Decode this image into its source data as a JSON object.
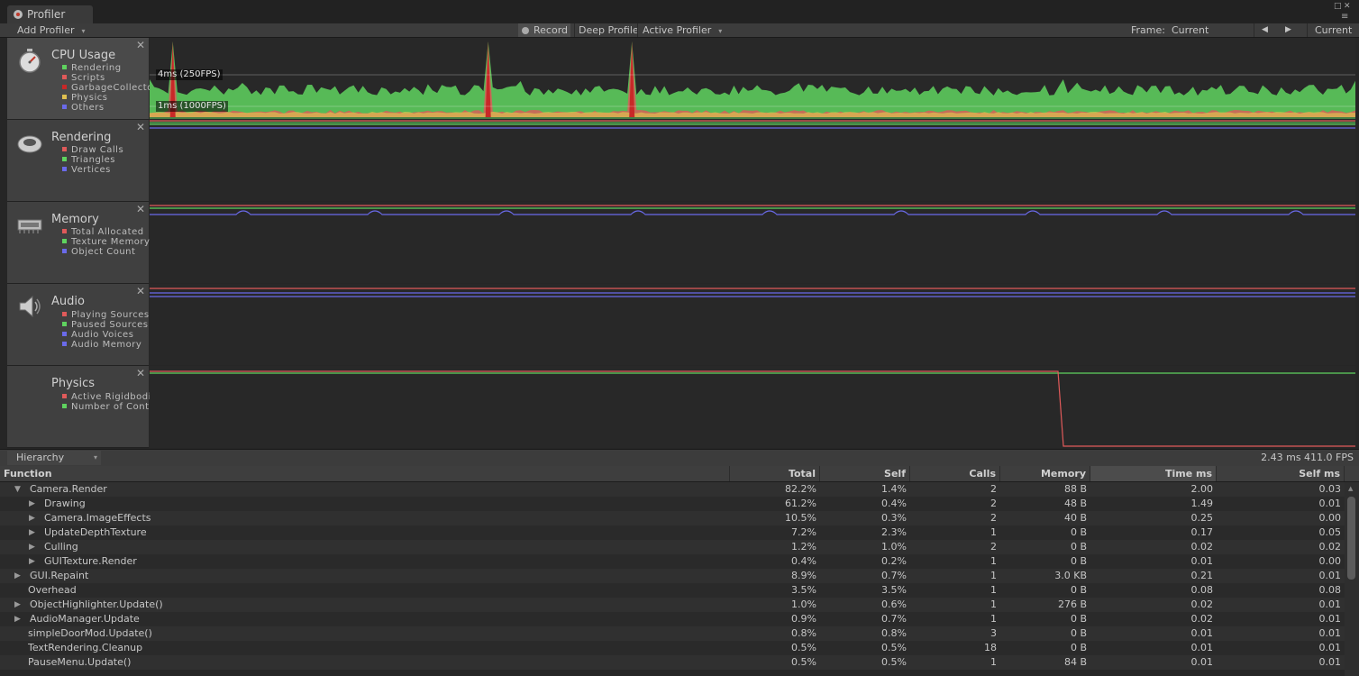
{
  "window": {
    "tab_label": "Profiler"
  },
  "toolbar": {
    "add_profiler": "Add Profiler",
    "record": "Record",
    "deep_profile": "Deep Profile",
    "active_profiler": "Active Profiler",
    "frame_label": "Frame:",
    "frame_value": "Current",
    "current_button": "Current"
  },
  "modules": [
    {
      "title": "CPU Usage",
      "legend": [
        "Rendering",
        "Scripts",
        "GarbageCollector",
        "Physics",
        "Others"
      ],
      "colors": [
        "#5fd35f",
        "#e05a5a",
        "#c82828",
        "#e0c050",
        "#6a6aea"
      ],
      "fps_top": "4ms (250FPS)",
      "fps_bottom": "1ms (1000FPS)"
    },
    {
      "title": "Rendering",
      "legend": [
        "Draw Calls",
        "Triangles",
        "Vertices"
      ],
      "colors": [
        "#e05a5a",
        "#5fd35f",
        "#6a6aea"
      ]
    },
    {
      "title": "Memory",
      "legend": [
        "Total Allocated",
        "Texture Memory",
        "Object Count"
      ],
      "colors": [
        "#e05a5a",
        "#5fd35f",
        "#6a6aea"
      ]
    },
    {
      "title": "Audio",
      "legend": [
        "Playing Sources",
        "Paused Sources",
        "Audio Voices",
        "Audio Memory"
      ],
      "colors": [
        "#e05a5a",
        "#5fd35f",
        "#6a6aea",
        "#6a6aea"
      ]
    },
    {
      "title": "Physics",
      "legend": [
        "Active Rigidbodies",
        "Number of Contacts"
      ],
      "colors": [
        "#e05a5a",
        "#5fd35f"
      ]
    }
  ],
  "hierarchy": {
    "view_mode": "Hierarchy",
    "frame_stats": "2.43 ms 411.0 FPS",
    "columns": [
      "Function",
      "Total",
      "Self",
      "Calls",
      "Memory",
      "Time ms",
      "Self ms"
    ],
    "rows": [
      {
        "name": "Camera.Render",
        "level": 0,
        "expander": "open",
        "total": "82.2%",
        "self": "1.4%",
        "calls": "2",
        "memory": "88 B",
        "time_ms": "2.00",
        "self_ms": "0.03"
      },
      {
        "name": "Drawing",
        "level": 1,
        "expander": "closed",
        "total": "61.2%",
        "self": "0.4%",
        "calls": "2",
        "memory": "48 B",
        "time_ms": "1.49",
        "self_ms": "0.01"
      },
      {
        "name": "Camera.ImageEffects",
        "level": 1,
        "expander": "closed",
        "total": "10.5%",
        "self": "0.3%",
        "calls": "2",
        "memory": "40 B",
        "time_ms": "0.25",
        "self_ms": "0.00"
      },
      {
        "name": "UpdateDepthTexture",
        "level": 1,
        "expander": "closed",
        "total": "7.2%",
        "self": "2.3%",
        "calls": "1",
        "memory": "0 B",
        "time_ms": "0.17",
        "self_ms": "0.05"
      },
      {
        "name": "Culling",
        "level": 1,
        "expander": "closed",
        "total": "1.2%",
        "self": "1.0%",
        "calls": "2",
        "memory": "0 B",
        "time_ms": "0.02",
        "self_ms": "0.02"
      },
      {
        "name": "GUITexture.Render",
        "level": 1,
        "expander": "closed",
        "total": "0.4%",
        "self": "0.2%",
        "calls": "1",
        "memory": "0 B",
        "time_ms": "0.01",
        "self_ms": "0.00"
      },
      {
        "name": "GUI.Repaint",
        "level": 0,
        "expander": "closed",
        "total": "8.9%",
        "self": "0.7%",
        "calls": "1",
        "memory": "3.0 KB",
        "time_ms": "0.21",
        "self_ms": "0.01"
      },
      {
        "name": "Overhead",
        "level": 0,
        "expander": "none",
        "total": "3.5%",
        "self": "3.5%",
        "calls": "1",
        "memory": "0 B",
        "time_ms": "0.08",
        "self_ms": "0.08"
      },
      {
        "name": "ObjectHighlighter.Update()",
        "level": 0,
        "expander": "closed",
        "total": "1.0%",
        "self": "0.6%",
        "calls": "1",
        "memory": "276 B",
        "time_ms": "0.02",
        "self_ms": "0.01"
      },
      {
        "name": "AudioManager.Update",
        "level": 0,
        "expander": "closed",
        "total": "0.9%",
        "self": "0.7%",
        "calls": "1",
        "memory": "0 B",
        "time_ms": "0.02",
        "self_ms": "0.01"
      },
      {
        "name": "simpleDoorMod.Update()",
        "level": 0,
        "expander": "none",
        "total": "0.8%",
        "self": "0.8%",
        "calls": "3",
        "memory": "0 B",
        "time_ms": "0.01",
        "self_ms": "0.01"
      },
      {
        "name": "TextRendering.Cleanup",
        "level": 0,
        "expander": "none",
        "total": "0.5%",
        "self": "0.5%",
        "calls": "18",
        "memory": "0 B",
        "time_ms": "0.01",
        "self_ms": "0.01"
      },
      {
        "name": "PauseMenu.Update()",
        "level": 0,
        "expander": "none",
        "total": "0.5%",
        "self": "0.5%",
        "calls": "1",
        "memory": "84 B",
        "time_ms": "0.01",
        "self_ms": "0.01"
      }
    ]
  }
}
